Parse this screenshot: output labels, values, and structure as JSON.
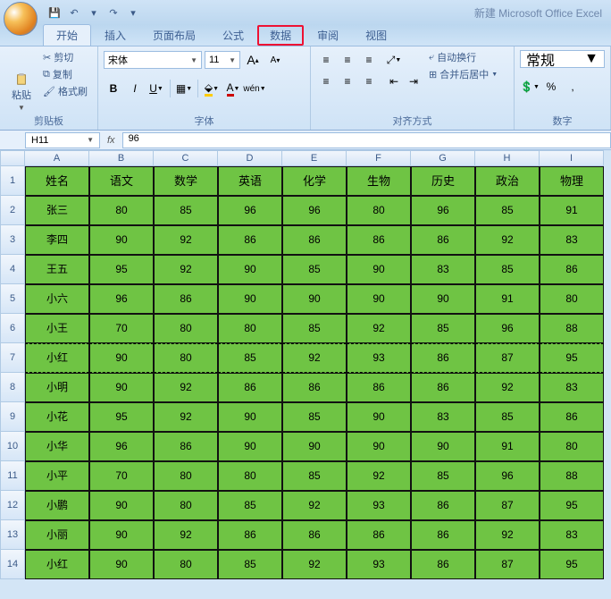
{
  "title": "新建 Microsoft Office Excel",
  "qat": {
    "save": "💾",
    "undo": "↶",
    "redo": "↷"
  },
  "tabs": [
    "开始",
    "插入",
    "页面布局",
    "公式",
    "数据",
    "审阅",
    "视图"
  ],
  "active_tab": 0,
  "highlighted_tab": 4,
  "ribbon": {
    "clipboard": {
      "label": "剪贴板",
      "paste": "粘贴",
      "cut": "剪切",
      "copy": "复制",
      "format_painter": "格式刷"
    },
    "font": {
      "label": "字体",
      "name": "宋体",
      "size": "11",
      "bold": "B",
      "italic": "I",
      "underline": "U",
      "grow": "A",
      "shrink": "A"
    },
    "align": {
      "label": "对齐方式",
      "wrap": "自动换行",
      "merge": "合并后居中"
    },
    "number": {
      "label": "数字",
      "format": "常规",
      "currency": "$",
      "percent": "%",
      "comma": ","
    }
  },
  "namebox": "H11",
  "formula": "96",
  "columns": [
    "A",
    "B",
    "C",
    "D",
    "E",
    "F",
    "G",
    "H",
    "I"
  ],
  "headers": [
    "姓名",
    "语文",
    "数学",
    "英语",
    "化学",
    "生物",
    "历史",
    "政治",
    "物理"
  ],
  "rows": [
    [
      "张三",
      "80",
      "85",
      "96",
      "96",
      "80",
      "96",
      "85",
      "91"
    ],
    [
      "李四",
      "90",
      "92",
      "86",
      "86",
      "86",
      "86",
      "92",
      "83"
    ],
    [
      "王五",
      "95",
      "92",
      "90",
      "85",
      "90",
      "83",
      "85",
      "86"
    ],
    [
      "小六",
      "96",
      "86",
      "90",
      "90",
      "90",
      "90",
      "91",
      "80"
    ],
    [
      "小王",
      "70",
      "80",
      "80",
      "85",
      "92",
      "85",
      "96",
      "88"
    ],
    [
      "小红",
      "90",
      "80",
      "85",
      "92",
      "93",
      "86",
      "87",
      "95"
    ],
    [
      "小明",
      "90",
      "92",
      "86",
      "86",
      "86",
      "86",
      "92",
      "83"
    ],
    [
      "小花",
      "95",
      "92",
      "90",
      "85",
      "90",
      "83",
      "85",
      "86"
    ],
    [
      "小华",
      "96",
      "86",
      "90",
      "90",
      "90",
      "90",
      "91",
      "80"
    ],
    [
      "小平",
      "70",
      "80",
      "80",
      "85",
      "92",
      "85",
      "96",
      "88"
    ],
    [
      "小鹏",
      "90",
      "80",
      "85",
      "92",
      "93",
      "86",
      "87",
      "95"
    ],
    [
      "小丽",
      "90",
      "92",
      "86",
      "86",
      "86",
      "86",
      "92",
      "83"
    ],
    [
      "小红",
      "90",
      "80",
      "85",
      "92",
      "93",
      "86",
      "87",
      "95"
    ]
  ],
  "chart_data": {
    "type": "table",
    "columns": [
      "姓名",
      "语文",
      "数学",
      "英语",
      "化学",
      "生物",
      "历史",
      "政治",
      "物理"
    ],
    "data": [
      {
        "姓名": "张三",
        "语文": 80,
        "数学": 85,
        "英语": 96,
        "化学": 96,
        "生物": 80,
        "历史": 96,
        "政治": 85,
        "物理": 91
      },
      {
        "姓名": "李四",
        "语文": 90,
        "数学": 92,
        "英语": 86,
        "化学": 86,
        "生物": 86,
        "历史": 86,
        "政治": 92,
        "物理": 83
      },
      {
        "姓名": "王五",
        "语文": 95,
        "数学": 92,
        "英语": 90,
        "化学": 85,
        "生物": 90,
        "历史": 83,
        "政治": 85,
        "物理": 86
      },
      {
        "姓名": "小六",
        "语文": 96,
        "数学": 86,
        "英语": 90,
        "化学": 90,
        "生物": 90,
        "历史": 90,
        "政治": 91,
        "物理": 80
      },
      {
        "姓名": "小王",
        "语文": 70,
        "数学": 80,
        "英语": 80,
        "化学": 85,
        "生物": 92,
        "历史": 85,
        "政治": 96,
        "物理": 88
      },
      {
        "姓名": "小红",
        "语文": 90,
        "数学": 80,
        "英语": 85,
        "化学": 92,
        "生物": 93,
        "历史": 86,
        "政治": 87,
        "物理": 95
      },
      {
        "姓名": "小明",
        "语文": 90,
        "数学": 92,
        "英语": 86,
        "化学": 86,
        "生物": 86,
        "历史": 86,
        "政治": 92,
        "物理": 83
      },
      {
        "姓名": "小花",
        "语文": 95,
        "数学": 92,
        "英语": 90,
        "化学": 85,
        "生物": 90,
        "历史": 83,
        "政治": 85,
        "物理": 86
      },
      {
        "姓名": "小华",
        "语文": 96,
        "数学": 86,
        "英语": 90,
        "化学": 90,
        "生物": 90,
        "历史": 90,
        "政治": 91,
        "物理": 80
      },
      {
        "姓名": "小平",
        "语文": 70,
        "数学": 80,
        "英语": 80,
        "化学": 85,
        "生物": 92,
        "历史": 85,
        "政治": 96,
        "物理": 88
      },
      {
        "姓名": "小鹏",
        "语文": 90,
        "数学": 80,
        "英语": 85,
        "化学": 92,
        "生物": 93,
        "历史": 86,
        "政治": 87,
        "物理": 95
      },
      {
        "姓名": "小丽",
        "语文": 90,
        "数学": 92,
        "英语": 86,
        "化学": 86,
        "生物": 86,
        "历史": 86,
        "政治": 92,
        "物理": 83
      },
      {
        "姓名": "小红",
        "语文": 90,
        "数学": 80,
        "英语": 85,
        "化学": 92,
        "生物": 93,
        "历史": 86,
        "政治": 87,
        "物理": 95
      }
    ]
  }
}
